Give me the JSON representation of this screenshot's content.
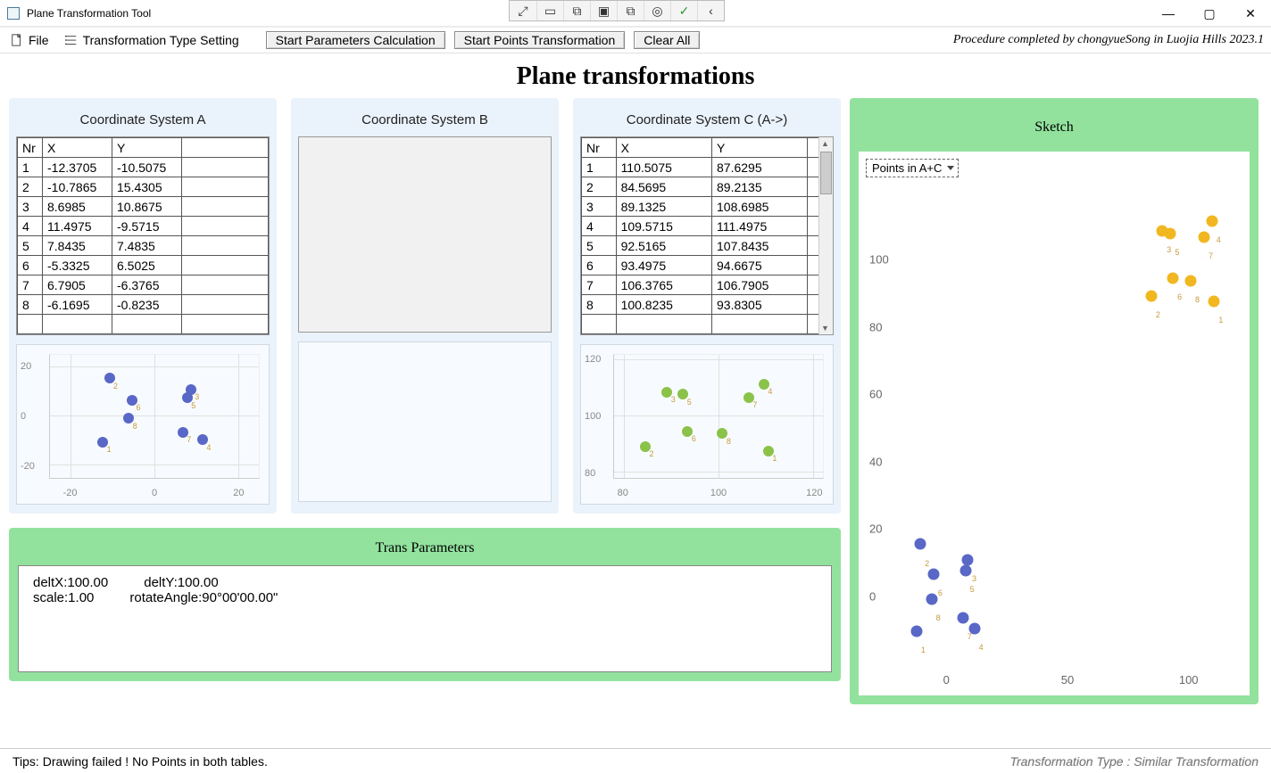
{
  "window": {
    "title": "Plane Transformation Tool",
    "credit": "Procedure completed by chongyueSong in Luojia Hills 2023.1"
  },
  "menu": {
    "file": "File",
    "transform_setting": "Transformation Type Setting",
    "btn_start_params": "Start Parameters Calculation",
    "btn_start_points": "Start Points Transformation",
    "btn_clear": "Clear All"
  },
  "main_title": "Plane transformations",
  "panels": {
    "a_title": "Coordinate System A",
    "b_title": "Coordinate System B",
    "c_title": "Coordinate System C (A->)"
  },
  "table_headers": {
    "nr": "Nr",
    "x": "X",
    "y": "Y"
  },
  "tableA": [
    {
      "nr": "1",
      "x": "-12.3705",
      "y": "-10.5075"
    },
    {
      "nr": "2",
      "x": "-10.7865",
      "y": "15.4305"
    },
    {
      "nr": "3",
      "x": "8.6985",
      "y": "10.8675"
    },
    {
      "nr": "4",
      "x": "11.4975",
      "y": "-9.5715"
    },
    {
      "nr": "5",
      "x": "7.8435",
      "y": "7.4835"
    },
    {
      "nr": "6",
      "x": "-5.3325",
      "y": "6.5025"
    },
    {
      "nr": "7",
      "x": "6.7905",
      "y": "-6.3765"
    },
    {
      "nr": "8",
      "x": "-6.1695",
      "y": "-0.8235"
    }
  ],
  "tableC": [
    {
      "nr": "1",
      "x": "110.5075",
      "y": "87.6295"
    },
    {
      "nr": "2",
      "x": "84.5695",
      "y": "89.2135"
    },
    {
      "nr": "3",
      "x": "89.1325",
      "y": "108.6985"
    },
    {
      "nr": "4",
      "x": "109.5715",
      "y": "111.4975"
    },
    {
      "nr": "5",
      "x": "92.5165",
      "y": "107.8435"
    },
    {
      "nr": "6",
      "x": "93.4975",
      "y": "94.6675"
    },
    {
      "nr": "7",
      "x": "106.3765",
      "y": "106.7905"
    },
    {
      "nr": "8",
      "x": "100.8235",
      "y": "93.8305"
    }
  ],
  "trans_params": {
    "title": "Trans Parameters",
    "deltX": "deltX:100.00",
    "deltY": "deltY:100.00",
    "scale": "scale:1.00",
    "rotate": "rotateAngle:90°00'00.00\""
  },
  "sketch": {
    "title": "Sketch",
    "dropdown_value": "Points in A+C"
  },
  "statusbar": {
    "tips": "Tips:  Drawing failed ! No Points in both tables.",
    "right": "Transformation Type : Similar Transformation"
  },
  "chart_data": [
    {
      "name": "miniA",
      "type": "scatter",
      "xlim": [
        -25,
        25
      ],
      "ylim": [
        -25,
        25
      ],
      "xticks": [
        -20,
        0,
        20
      ],
      "yticks": [
        -20,
        0,
        20
      ],
      "series": [
        {
          "name": "A",
          "color": "#5967c6",
          "points": [
            [
              -12.37,
              -10.51
            ],
            [
              -10.79,
              15.43
            ],
            [
              8.7,
              10.87
            ],
            [
              11.5,
              -9.57
            ],
            [
              7.84,
              7.48
            ],
            [
              -5.33,
              6.5
            ],
            [
              6.79,
              -6.38
            ],
            [
              -6.17,
              -0.82
            ]
          ]
        }
      ]
    },
    {
      "name": "miniC",
      "type": "scatter",
      "xlim": [
        78,
        122
      ],
      "ylim": [
        78,
        122
      ],
      "xticks": [
        80,
        100,
        120
      ],
      "yticks": [
        80,
        100,
        120
      ],
      "series": [
        {
          "name": "C",
          "color": "#8bc24a",
          "points": [
            [
              110.51,
              87.63
            ],
            [
              84.57,
              89.21
            ],
            [
              89.13,
              108.7
            ],
            [
              109.57,
              111.5
            ],
            [
              92.52,
              107.84
            ],
            [
              93.5,
              94.67
            ],
            [
              106.38,
              106.79
            ],
            [
              100.82,
              93.83
            ]
          ]
        }
      ]
    },
    {
      "name": "sketch",
      "type": "scatter",
      "xlim": [
        -20,
        120
      ],
      "ylim": [
        -20,
        120
      ],
      "xticks": [
        0,
        50,
        100
      ],
      "yticks": [
        0,
        20,
        40,
        60,
        80,
        100
      ],
      "series": [
        {
          "name": "A",
          "color": "#5967c6",
          "points": [
            [
              -12.37,
              -10.51
            ],
            [
              -10.79,
              15.43
            ],
            [
              8.7,
              10.87
            ],
            [
              11.5,
              -9.57
            ],
            [
              7.84,
              7.48
            ],
            [
              -5.33,
              6.5
            ],
            [
              6.79,
              -6.38
            ],
            [
              -6.17,
              -0.82
            ]
          ]
        },
        {
          "name": "C",
          "color": "#f1b721",
          "points": [
            [
              110.51,
              87.63
            ],
            [
              84.57,
              89.21
            ],
            [
              89.13,
              108.7
            ],
            [
              109.57,
              111.5
            ],
            [
              92.52,
              107.84
            ],
            [
              93.5,
              94.67
            ],
            [
              106.38,
              106.79
            ],
            [
              100.82,
              93.83
            ]
          ]
        }
      ]
    }
  ]
}
